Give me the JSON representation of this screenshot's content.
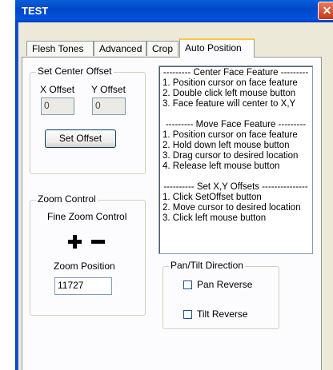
{
  "window": {
    "title": "TEST",
    "close_label": "✕"
  },
  "tabs": [
    "Flesh Tones",
    "Advanced",
    "Crop",
    "Auto Position"
  ],
  "set_center_offset": {
    "group_label": "Set Center Offset",
    "x_label": "X Offset",
    "y_label": "Y Offset",
    "x_value": "0",
    "y_value": "0",
    "button_label": "Set Offset"
  },
  "zoom_control": {
    "group_label": "Zoom Control",
    "fine_label": "Fine Zoom Control",
    "plus_icon": "plus-icon",
    "minus_icon": "minus-icon",
    "position_label": "Zoom Position",
    "position_value": "11727"
  },
  "instructions": [
    "--------- Center Face Feature ---------",
    "1. Position cursor on face feature",
    "2. Double click left mouse button",
    "3. Face feature will center to X,Y",
    "",
    "--------- Move Face Feature ---------",
    "1. Position cursor on face feature",
    "2. Hold down left mouse button",
    "3. Drag cursor to desired location",
    "4. Release left mouse button",
    "",
    "---------- Set X,Y Offsets ---------------",
    "1. Click SetOffset button",
    "2. Move cursor to desired location",
    "3. Click left mouse button"
  ],
  "pan_tilt": {
    "group_label": "Pan/Tilt Direction",
    "pan_label": "Pan Reverse",
    "tilt_label": "Tilt Reverse",
    "pan_checked": false,
    "tilt_checked": false
  }
}
